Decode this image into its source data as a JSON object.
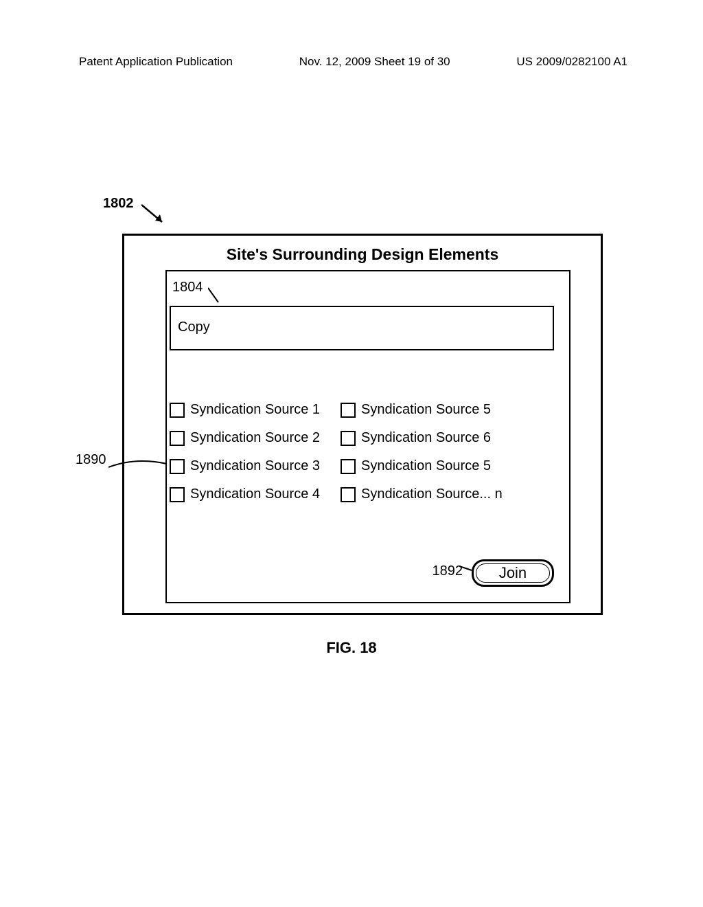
{
  "header": {
    "left": "Patent Application Publication",
    "center": "Nov. 12, 2009  Sheet 19 of 30",
    "right": "US 2009/0282100 A1"
  },
  "refs": {
    "r1802": "1802",
    "r1804": "1804",
    "r1890": "1890",
    "r1892": "1892"
  },
  "outer": {
    "title": "Site's Surrounding Design Elements"
  },
  "copy": {
    "label": "Copy"
  },
  "sources": {
    "col1": [
      "Syndication Source 1",
      "Syndication Source 2",
      "Syndication Source 3",
      "Syndication Source 4"
    ],
    "col2": [
      "Syndication Source 5",
      "Syndication Source 6",
      "Syndication Source 5",
      "Syndication Source... n"
    ]
  },
  "join": {
    "label": "Join"
  },
  "figure": {
    "label": "FIG. 18"
  }
}
